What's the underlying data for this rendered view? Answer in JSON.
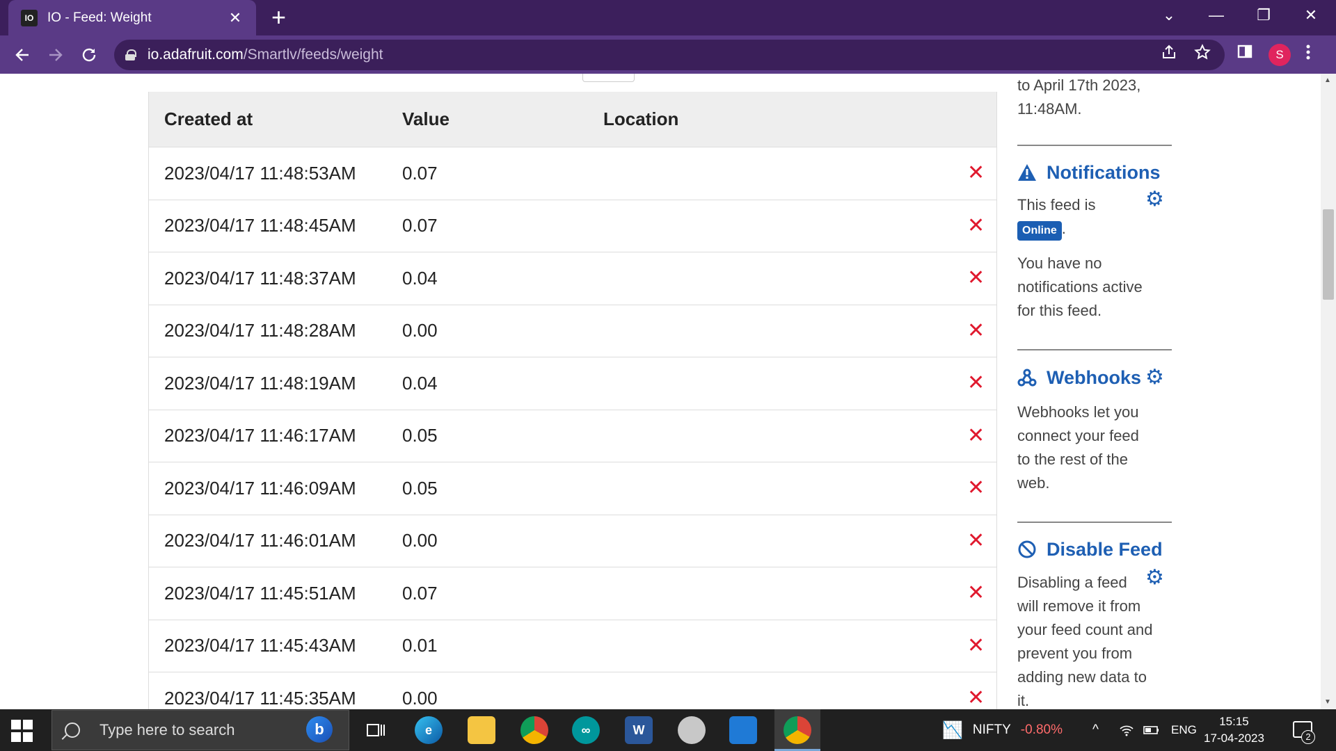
{
  "browser": {
    "tab_title": "IO - Feed: Weight",
    "tab_close": "✕",
    "new_tab": "+",
    "url_host": "io.adafruit.com",
    "url_path": "/Smartlv/feeds/weight",
    "profile_initial": "S",
    "controls": {
      "chevron": "⌄",
      "minimize": "—",
      "restore": "❐",
      "close": "✕"
    }
  },
  "table": {
    "headers": [
      "Created at",
      "Value",
      "Location"
    ],
    "rows": [
      {
        "created_at": "2023/04/17 11:48:53AM",
        "value": "0.07"
      },
      {
        "created_at": "2023/04/17 11:48:45AM",
        "value": "0.07"
      },
      {
        "created_at": "2023/04/17 11:48:37AM",
        "value": "0.04"
      },
      {
        "created_at": "2023/04/17 11:48:28AM",
        "value": "0.00"
      },
      {
        "created_at": "2023/04/17 11:48:19AM",
        "value": "0.04"
      },
      {
        "created_at": "2023/04/17 11:46:17AM",
        "value": "0.05"
      },
      {
        "created_at": "2023/04/17 11:46:09AM",
        "value": "0.05"
      },
      {
        "created_at": "2023/04/17 11:46:01AM",
        "value": "0.00"
      },
      {
        "created_at": "2023/04/17 11:45:51AM",
        "value": "0.07"
      },
      {
        "created_at": "2023/04/17 11:45:43AM",
        "value": "0.01"
      },
      {
        "created_at": "2023/04/17 11:45:35AM",
        "value": "0.00"
      }
    ],
    "delete_glyph": "✕"
  },
  "sidebar": {
    "top_text_1": "to April 17th 2023,",
    "top_text_2": "11:48AM.",
    "notifications": {
      "title": "Notifications",
      "status_prefix": "This feed is",
      "status_badge": "Online",
      "status_suffix": ".",
      "line1": "You have no",
      "line2": "notifications active",
      "line3": "for this feed."
    },
    "webhooks": {
      "title": "Webhooks",
      "line1": "Webhooks let you",
      "line2": "connect your feed",
      "line3": "to the rest of the",
      "line4": "web."
    },
    "disable": {
      "title": "Disable Feed",
      "line1": "Disabling a feed",
      "line2": "will remove it from",
      "line3": "your feed count and",
      "line4": "prevent you from",
      "line5": "adding new data to",
      "line6": "it."
    }
  },
  "taskbar": {
    "search_placeholder": "Type here to search",
    "ticker_name": "NIFTY",
    "ticker_change": "-0.80%",
    "language": "ENG",
    "time": "15:15",
    "date": "17-04-2023",
    "notification_count": "2"
  },
  "colors": {
    "tabbar": "#3c1f5c",
    "toolbar": "#5a3a86",
    "link_blue": "#1e5fb3",
    "delete_red": "#e0192e"
  }
}
